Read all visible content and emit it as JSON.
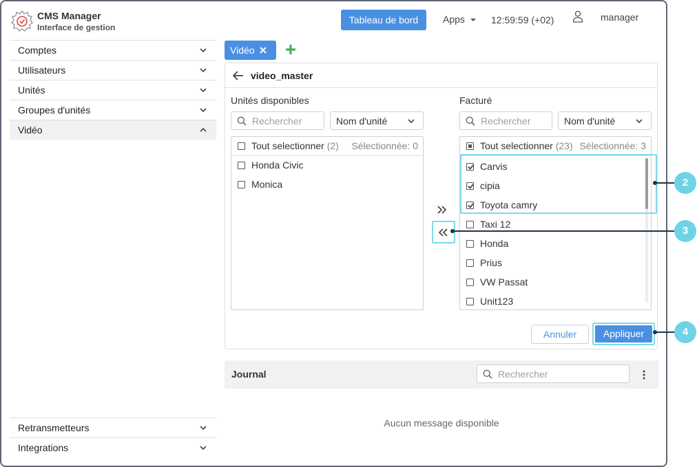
{
  "header": {
    "title": "CMS Manager",
    "subtitle": "Interface de gestion",
    "dashboard_button": "Tableau de bord",
    "apps_label": "Apps",
    "clock": "12:59:59 (+02)",
    "username": "manager"
  },
  "sidebar": {
    "items": [
      {
        "label": "Comptes"
      },
      {
        "label": "Utilisateurs"
      },
      {
        "label": "Unités"
      },
      {
        "label": "Groupes d'unités"
      },
      {
        "label": "Vidéo"
      }
    ],
    "bottom_items": [
      {
        "label": "Retransmetteurs"
      },
      {
        "label": "Integrations"
      }
    ]
  },
  "tabs": {
    "active_tab": "Vidéo"
  },
  "panel": {
    "title": "video_master",
    "left": {
      "label": "Unités disponibles",
      "search_placeholder": "Rechercher",
      "sort_value": "Nom d'unité",
      "select_all": "Tout selectionner",
      "count": "(2)",
      "selected": "Sélectionnée: 0",
      "items": [
        "Honda Civic",
        "Monica"
      ]
    },
    "right": {
      "label": "Facturé",
      "search_placeholder": "Rechercher",
      "sort_value": "Nom d'unité",
      "select_all": "Tout selectionner",
      "count": "(23)",
      "selected": "Sélectionnée: 3",
      "items": [
        {
          "label": "Carvis",
          "checked": true
        },
        {
          "label": "cipia",
          "checked": true
        },
        {
          "label": "Toyota camry",
          "checked": true
        },
        {
          "label": "Taxi 12",
          "checked": false
        },
        {
          "label": "Honda",
          "checked": false
        },
        {
          "label": "Prius",
          "checked": false
        },
        {
          "label": "VW Passat",
          "checked": false
        },
        {
          "label": "Unit123",
          "checked": false
        }
      ]
    },
    "cancel_button": "Annuler",
    "apply_button": "Appliquer"
  },
  "callouts": [
    "2",
    "3",
    "4"
  ],
  "journal": {
    "title": "Journal",
    "search_placeholder": "Rechercher",
    "empty_message": "Aucun message disponible"
  },
  "colors": {
    "accent": "#4a90e2",
    "highlight": "#7fd9ea",
    "badge": "#6fd3e6"
  }
}
